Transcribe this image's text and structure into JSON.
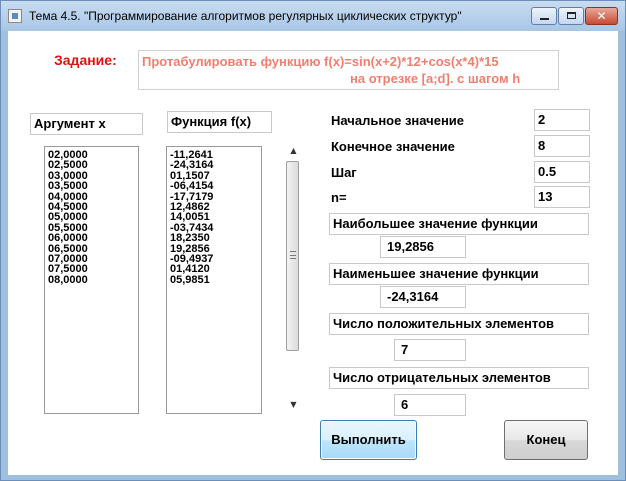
{
  "window": {
    "title": "Тема  4.5. \"Программирование алгоритмов регулярных циклических  структур\"",
    "buttons": {
      "minimize": "minimize",
      "maximize": "maximize",
      "close": "✕"
    }
  },
  "task": {
    "label": "Задание:",
    "line1": "Протабулировать функцию f(x)=sin(x+2)*12+cos(x*4)*15",
    "line2": "на отрезке [a;d]. с шагом h"
  },
  "columns": {
    "argument_header": "Аргумент x",
    "function_header": "Функция f(x)"
  },
  "arguments": [
    "02,0000",
    "02,5000",
    "03,0000",
    "03,5000",
    "04,0000",
    "04,5000",
    "05,0000",
    "05,5000",
    "06,0000",
    "06,5000",
    "07,0000",
    "07,5000",
    "08,0000"
  ],
  "function_values": [
    "-11,2641",
    "-24,3164",
    "01,1507",
    "-06,4154",
    "-17,7179",
    "12,4862",
    "14,0051",
    "-03,7434",
    "18,2350",
    "19,2856",
    "-09,4937",
    "01,4120",
    "05,9851"
  ],
  "params": {
    "start_label": "Начальное значение",
    "start_value": "2",
    "end_label": "Конечное значение",
    "end_value": "8",
    "step_label": "Шаг",
    "step_value": "0.5",
    "n_label": "n=",
    "n_value": "13"
  },
  "results": {
    "max_label": "Наибольшее значение функции",
    "max_value": "19,2856",
    "min_label": "Наименьшее значение функции",
    "min_value": "-24,3164",
    "pos_label": "Число положительных элементов",
    "pos_value": "7",
    "neg_label": "Число отрицательных элементов",
    "neg_value": "6"
  },
  "actions": {
    "run_label": "Выполнить",
    "end_label": "Конец"
  },
  "icons": {
    "scroll_up": "▲",
    "scroll_down": "▼"
  }
}
